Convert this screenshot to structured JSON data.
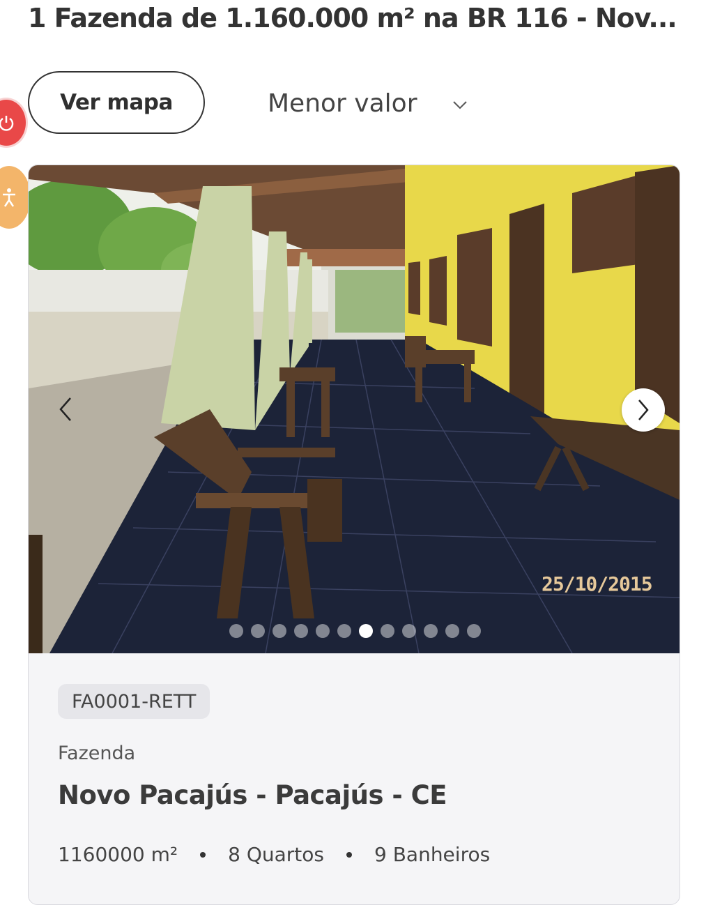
{
  "header": {
    "title": "1 Fazenda de 1.160.000 m² na BR 116 - Nov..."
  },
  "toolbar": {
    "map_button": "Ver mapa",
    "sort_selected": "Menor valor"
  },
  "listing": {
    "photo": {
      "date_stamp": "25/10/2015",
      "dots_total": 12,
      "dot_active_index": 6
    },
    "reference": "FA0001-RETT",
    "property_type": "Fazenda",
    "location": "Novo Pacajús - Pacajús - CE",
    "features": {
      "area": "1160000 m²",
      "bedrooms": "8 Quartos",
      "bathrooms": "9 Banheiros"
    }
  },
  "colors": {
    "wall_yellow": "#e8d84a",
    "floor_tile": "#1c2338",
    "float_red": "#e94848",
    "float_orange": "#f3b56a"
  }
}
